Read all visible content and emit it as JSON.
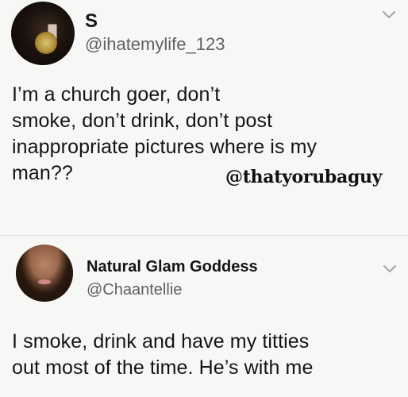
{
  "tweets": [
    {
      "display_name": "S",
      "handle": "@ihatemylife_123",
      "text": "I’m a church goer, don’t\nsmoke, don’t drink, don’t post\ninappropriate pictures where is my\nman??",
      "avatar_icon": "user-avatar",
      "menu_icon": "chevron-down-icon"
    },
    {
      "display_name": "Natural Glam Goddess",
      "handle": "@Chaantellie",
      "text": "I smoke, drink and have my titties\nout most of the time. He’s with me",
      "avatar_icon": "user-avatar",
      "menu_icon": "chevron-down-icon"
    }
  ],
  "watermark": "@thatyorubaguy"
}
